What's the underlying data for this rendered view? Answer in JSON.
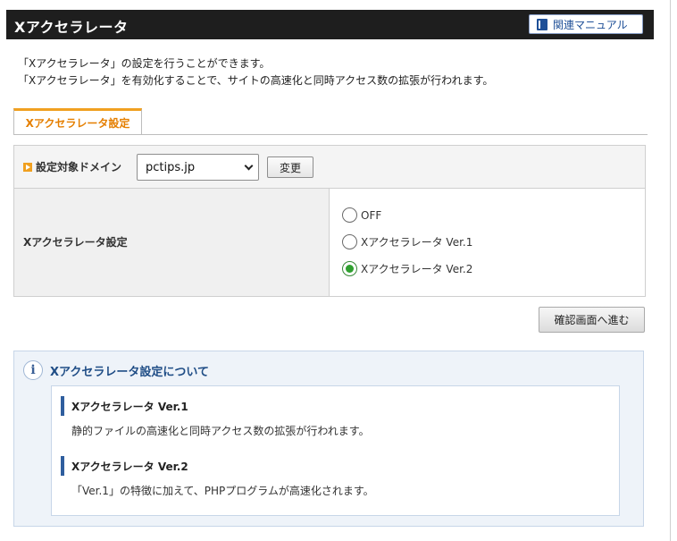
{
  "header": {
    "title": "Xアクセラレータ",
    "manual_button": "関連マニュアル"
  },
  "description": {
    "line1": "「Xアクセラレータ」の設定を行うことができます。",
    "line2": "「Xアクセラレータ」を有効化することで、サイトの高速化と同時アクセス数の拡張が行われます。"
  },
  "tabs": [
    {
      "label": "Xアクセラレータ設定",
      "active": true
    }
  ],
  "domain_row": {
    "label": "設定対象ドメイン",
    "selected_domain": "pctips.jp",
    "change_button": "変更"
  },
  "accelerator_row": {
    "label": "Xアクセラレータ設定",
    "options": [
      {
        "label": "OFF",
        "checked": false
      },
      {
        "label": "Xアクセラレータ Ver.1",
        "checked": false
      },
      {
        "label": "Xアクセラレータ Ver.2",
        "checked": true
      }
    ]
  },
  "confirm_button": "確認画面へ進む",
  "info": {
    "title": "Xアクセラレータ設定について",
    "sections": [
      {
        "title": "Xアクセラレータ Ver.1",
        "body": "静的ファイルの高速化と同時アクセス数の拡張が行われます。"
      },
      {
        "title": "Xアクセラレータ Ver.2",
        "body": "「Ver.1」の特徴に加えて、PHPプログラムが高速化されます。"
      }
    ]
  },
  "colors": {
    "header_bg": "#1e1e1e",
    "tab_accent": "#f0a020",
    "tab_text": "#e57f00",
    "info_title": "#1f4d86",
    "radio_checked": "#2fa02f"
  }
}
